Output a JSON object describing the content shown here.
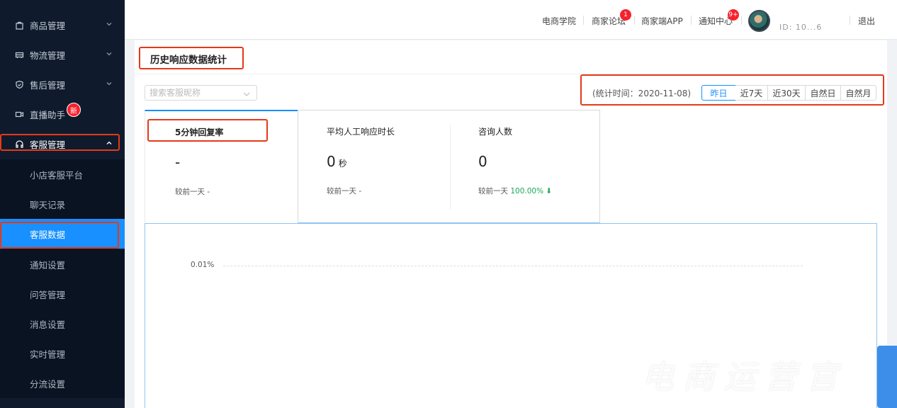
{
  "sidebar": {
    "items": [
      {
        "label": "商品管理",
        "icon": "bag-icon"
      },
      {
        "label": "物流管理",
        "icon": "truck-icon"
      },
      {
        "label": "售后管理",
        "icon": "shield-icon"
      },
      {
        "label": "直播助手",
        "icon": "camera-icon",
        "badge": "新"
      },
      {
        "label": "客服管理",
        "icon": "headset-icon"
      }
    ],
    "sub_items": [
      {
        "label": "小店客服平台"
      },
      {
        "label": "聊天记录"
      },
      {
        "label": "客服数据"
      },
      {
        "label": "通知设置"
      },
      {
        "label": "问答管理"
      },
      {
        "label": "消息设置"
      },
      {
        "label": "实时管理"
      },
      {
        "label": "分流设置"
      }
    ],
    "active_sub": "客服数据"
  },
  "topbar": {
    "links": [
      "电商学院",
      "商家论坛",
      "商家端APP",
      "通知中心"
    ],
    "forum_badge": "1",
    "notify_badge": "9+",
    "user_id": "ID: 10...6",
    "logout": "退出"
  },
  "panel": {
    "title": "历史响应数据统计",
    "search_placeholder": "搜索客服昵称",
    "period_label": "(统计时间：2020-11-08)",
    "ranges": [
      "昨日",
      "近7天",
      "近30天",
      "自然日",
      "自然月"
    ],
    "active_range": "昨日"
  },
  "metrics": [
    {
      "name": "5分钟回复率",
      "value": "-",
      "unit": "",
      "compare_label": "较前一天 -",
      "compare_value": ""
    },
    {
      "name": "平均人工响应时长",
      "value": "0",
      "unit": "秒",
      "compare_label": "较前一天 -",
      "compare_value": ""
    },
    {
      "name": "咨询人数",
      "value": "0",
      "unit": "",
      "compare_label": "较前一天",
      "compare_value": "100.00%"
    }
  ],
  "chart": {
    "y_tick": "0.01%"
  },
  "watermark": "电商运营官",
  "colors": {
    "sidebar_bg": "#0f1b2d",
    "accent": "#1890ff",
    "highlight": "#e4391b",
    "badge": "#f5222d",
    "positive": "#1aaa55"
  }
}
